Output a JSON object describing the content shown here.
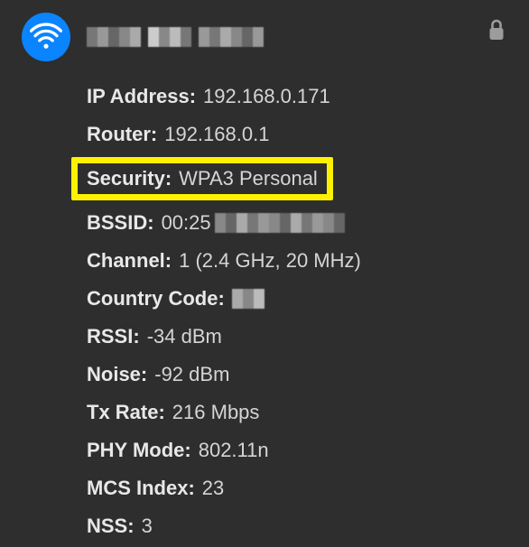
{
  "header": {
    "wifi_icon": "wifi-icon",
    "ssid_redacted": true,
    "lock_icon": "lock-icon"
  },
  "details": {
    "ip_address": {
      "label": "IP Address:",
      "value": "192.168.0.171"
    },
    "router": {
      "label": "Router:",
      "value": "192.168.0.1"
    },
    "security": {
      "label": "Security:",
      "value": "WPA3 Personal",
      "highlighted": true
    },
    "bssid": {
      "label": "BSSID:",
      "value_prefix": "00:25",
      "value_redacted_suffix": true
    },
    "channel": {
      "label": "Channel:",
      "value": "1 (2.4 GHz, 20 MHz)"
    },
    "country_code": {
      "label": "Country Code:",
      "value_redacted": true
    },
    "rssi": {
      "label": "RSSI:",
      "value": "-34 dBm"
    },
    "noise": {
      "label": "Noise:",
      "value": "-92 dBm"
    },
    "tx_rate": {
      "label": "Tx Rate:",
      "value": "216 Mbps"
    },
    "phy_mode": {
      "label": "PHY Mode:",
      "value": "802.11n"
    },
    "mcs_index": {
      "label": "MCS Index:",
      "value": "23"
    },
    "nss": {
      "label": "NSS:",
      "value": "3"
    }
  },
  "colors": {
    "accent": "#0b84ff",
    "highlight": "#fff200",
    "background": "#2e2e2e"
  }
}
